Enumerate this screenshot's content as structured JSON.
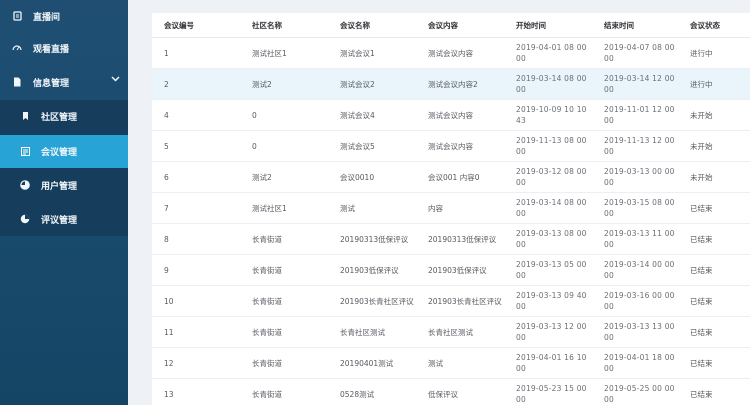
{
  "sidebar": {
    "items": [
      {
        "label": "直播间",
        "icon": "live-room-icon"
      },
      {
        "label": "观看直播",
        "icon": "watch-live-icon"
      },
      {
        "label": "信息管理",
        "icon": "info-doc-icon"
      },
      {
        "label": "社区管理",
        "icon": "community-flag-icon"
      },
      {
        "label": "会议管理",
        "icon": "meeting-list-icon"
      },
      {
        "label": "用户管理",
        "icon": "user-pie-icon"
      },
      {
        "label": "评议管理",
        "icon": "review-pie-icon"
      }
    ],
    "active_bg": "#27a3d6"
  },
  "table": {
    "headers": [
      "会议编号",
      "社区名称",
      "会议名称",
      "会议内容",
      "开始时间",
      "结束时间",
      "会议状态"
    ],
    "rows": [
      [
        "1",
        "测试社区1",
        "测试会议1",
        "测试会议内容",
        "2019-04-01 08 00 00",
        "2019-04-07 08 00 00",
        "进行中"
      ],
      [
        "2",
        "测试2",
        "测试会议2",
        "测试会议内容2",
        "2019-03-14 08 00 00",
        "2019-03-14 12 00 00",
        "进行中"
      ],
      [
        "4",
        "0",
        "测试会议4",
        "测试会议内容",
        "2019-10-09 10 10 43",
        "2019-11-01 12 00 00",
        "未开始"
      ],
      [
        "5",
        "0",
        "测试会议5",
        "测试会议内容",
        "2019-11-13 08 00 00",
        "2019-11-13 12 00 00",
        "未开始"
      ],
      [
        "6",
        "测试2",
        "会议0010",
        "会议001 内容0",
        "2019-03-12 08 00 00",
        "2019-03-13 00 00 00",
        "未开始"
      ],
      [
        "7",
        "测试社区1",
        "测试",
        "内容",
        "2019-03-14 08 00 00",
        "2019-03-15 08 00 00",
        "已结束"
      ],
      [
        "8",
        "长青街道",
        "20190313低保评议",
        "20190313低保评议",
        "2019-03-13 08 00 00",
        "2019-03-13 11 00 00",
        "已结束"
      ],
      [
        "9",
        "长青街道",
        "201903低保评议",
        "201903低保评议",
        "2019-03-13 05 00 00",
        "2019-03-14 00 00 00",
        "已结束"
      ],
      [
        "10",
        "长青街道",
        "201903长青社区评议",
        "201903长青社区评议",
        "2019-03-13 09 40 00",
        "2019-03-16 00 00 00",
        "已结束"
      ],
      [
        "11",
        "长青街道",
        "长青社区测试",
        "长青社区测试",
        "2019-03-13 12 00 00",
        "2019-03-13 13 00 00",
        "已结束"
      ],
      [
        "12",
        "长青街道",
        "20190401测试",
        "测试",
        "2019-04-01 16 10 00",
        "2019-04-01 18 00 00",
        "已结束"
      ],
      [
        "13",
        "长青街道",
        "0528测试",
        "低保评议",
        "2019-05-23 15 00 00",
        "2019-05-25 00 00 00",
        "已结束"
      ]
    ],
    "highlight_row": 1,
    "highlight_bg": "#eaf4fb"
  }
}
